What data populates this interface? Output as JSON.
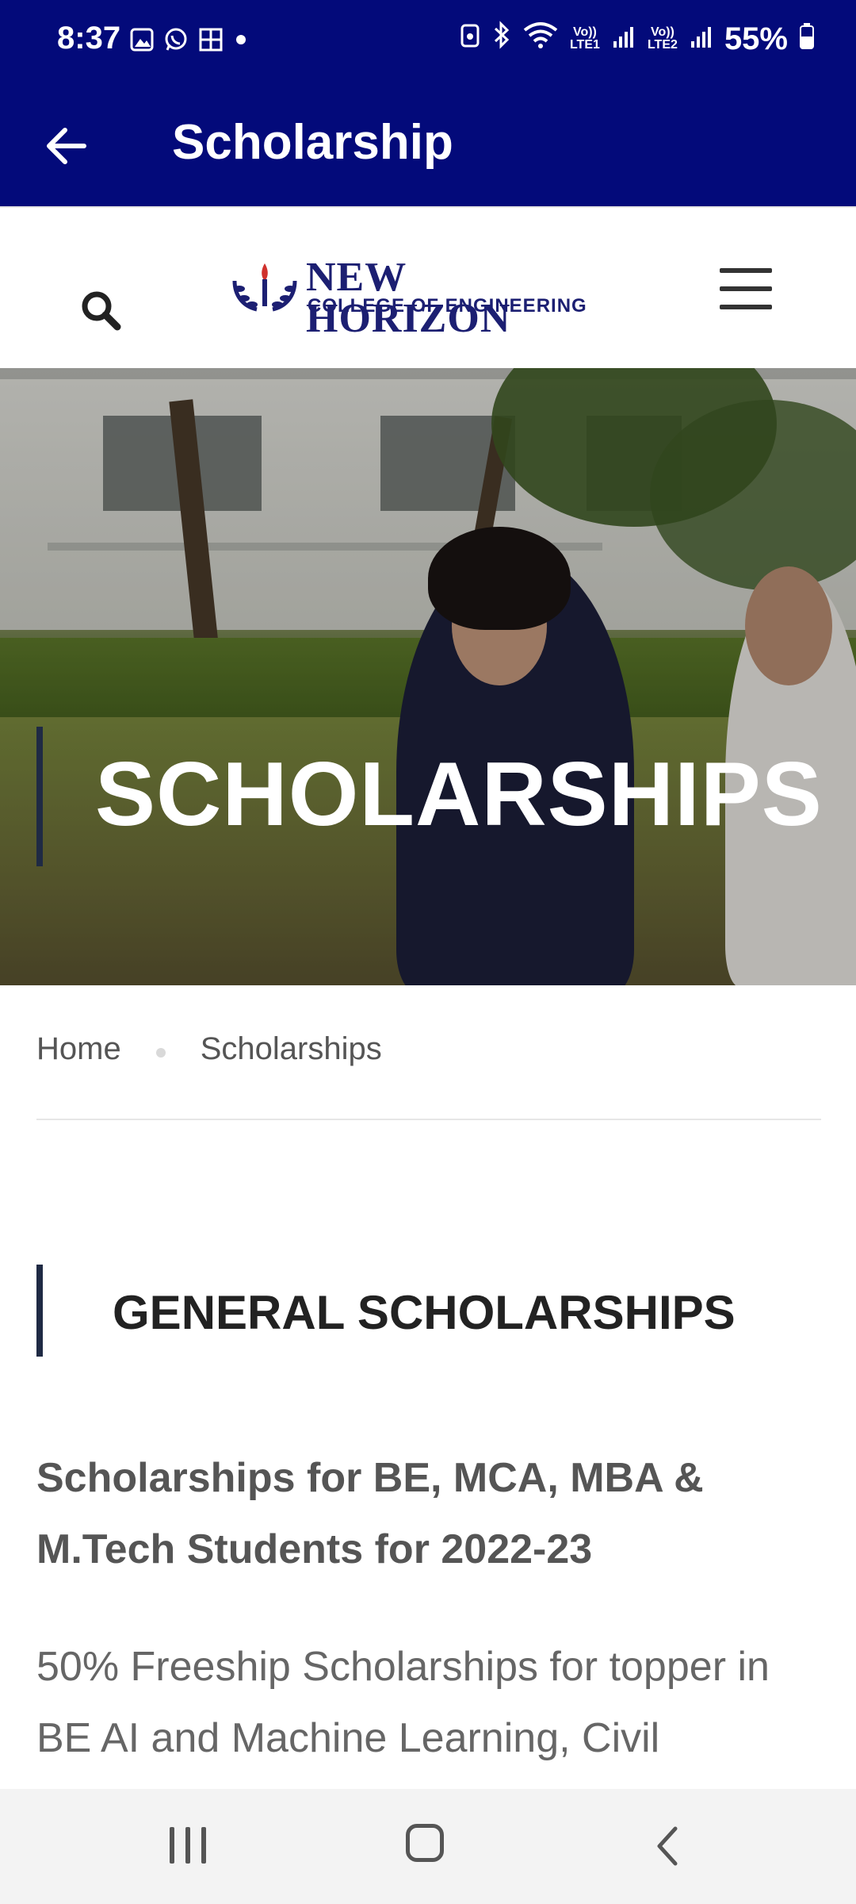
{
  "status_bar": {
    "time": "8:37",
    "battery": "55%",
    "lte1": "Vo)) LTE1",
    "lte2": "Vo)) LTE2"
  },
  "app_bar": {
    "title": "Scholarship",
    "back_icon": "arrow-left-icon",
    "color": "#030a7a"
  },
  "header": {
    "logo_line1": "NEW HORIZON",
    "logo_line2": "COLLEGE OF ENGINEERING",
    "search_icon": "search-icon",
    "menu_icon": "hamburger-menu-icon"
  },
  "hero": {
    "title": "SCHOLARSHIPS"
  },
  "breadcrumb": {
    "home": "Home",
    "current": "Scholarships"
  },
  "section": {
    "title": "GENERAL SCHOLARSHIPS",
    "subheading": "Scholarships for BE, MCA, MBA & M.Tech Students for 2022-23",
    "body": "50% Freeship Scholarships for topper in BE AI and Machine Learning, Civil"
  },
  "nav_bar": {
    "recent_icon": "recent-apps-icon",
    "home_icon": "home-icon",
    "back_icon": "back-chevron-icon"
  }
}
